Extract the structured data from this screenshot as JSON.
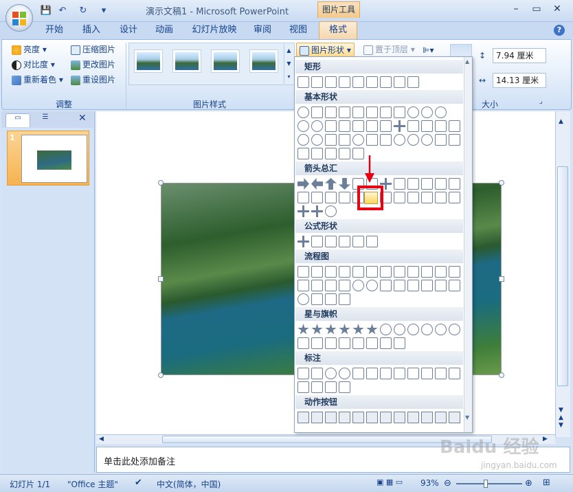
{
  "window": {
    "title": "演示文稿1 - Microsoft PowerPoint",
    "context_group": "图片工具"
  },
  "quick_access": {
    "save_icon": "save-icon",
    "undo_icon": "undo-icon",
    "redo_icon": "redo-icon",
    "customize": "▾"
  },
  "tabs": [
    "开始",
    "插入",
    "设计",
    "动画",
    "幻灯片放映",
    "审阅",
    "视图",
    "格式"
  ],
  "ribbon": {
    "adjust": {
      "label": "调整",
      "brightness": "亮度 ▾",
      "contrast": "对比度 ▾",
      "recolor": "重新着色 ▾",
      "compress": "压缩图片",
      "change": "更改图片",
      "reset": "重设图片"
    },
    "picture_styles": {
      "label": "图片样式",
      "shape_button": "图片形状 ▾"
    },
    "arrange": {
      "bring_front": "置于顶层 ▾"
    },
    "size": {
      "label": "大小",
      "height": "7.94 厘米",
      "width": "14.13 厘米"
    }
  },
  "slides_pane": {
    "slide_number": "1"
  },
  "shape_menu": {
    "sections": [
      "矩形",
      "基本形状",
      "箭头总汇",
      "公式形状",
      "流程图",
      "星与旗帜",
      "标注",
      "动作按钮"
    ]
  },
  "notes": {
    "placeholder": "单击此处添加备注"
  },
  "status": {
    "slide": "幻灯片 1/1",
    "theme": "\"Office 主题\"",
    "language": "中文(简体，中国)",
    "zoom": "93%"
  },
  "watermark": {
    "brand": "Baidu 经验",
    "url": "jingyan.baidu.com"
  },
  "colors": {
    "accent": "#e60012",
    "ribbon_blue": "#15428b",
    "context_orange": "#f3c98c"
  }
}
